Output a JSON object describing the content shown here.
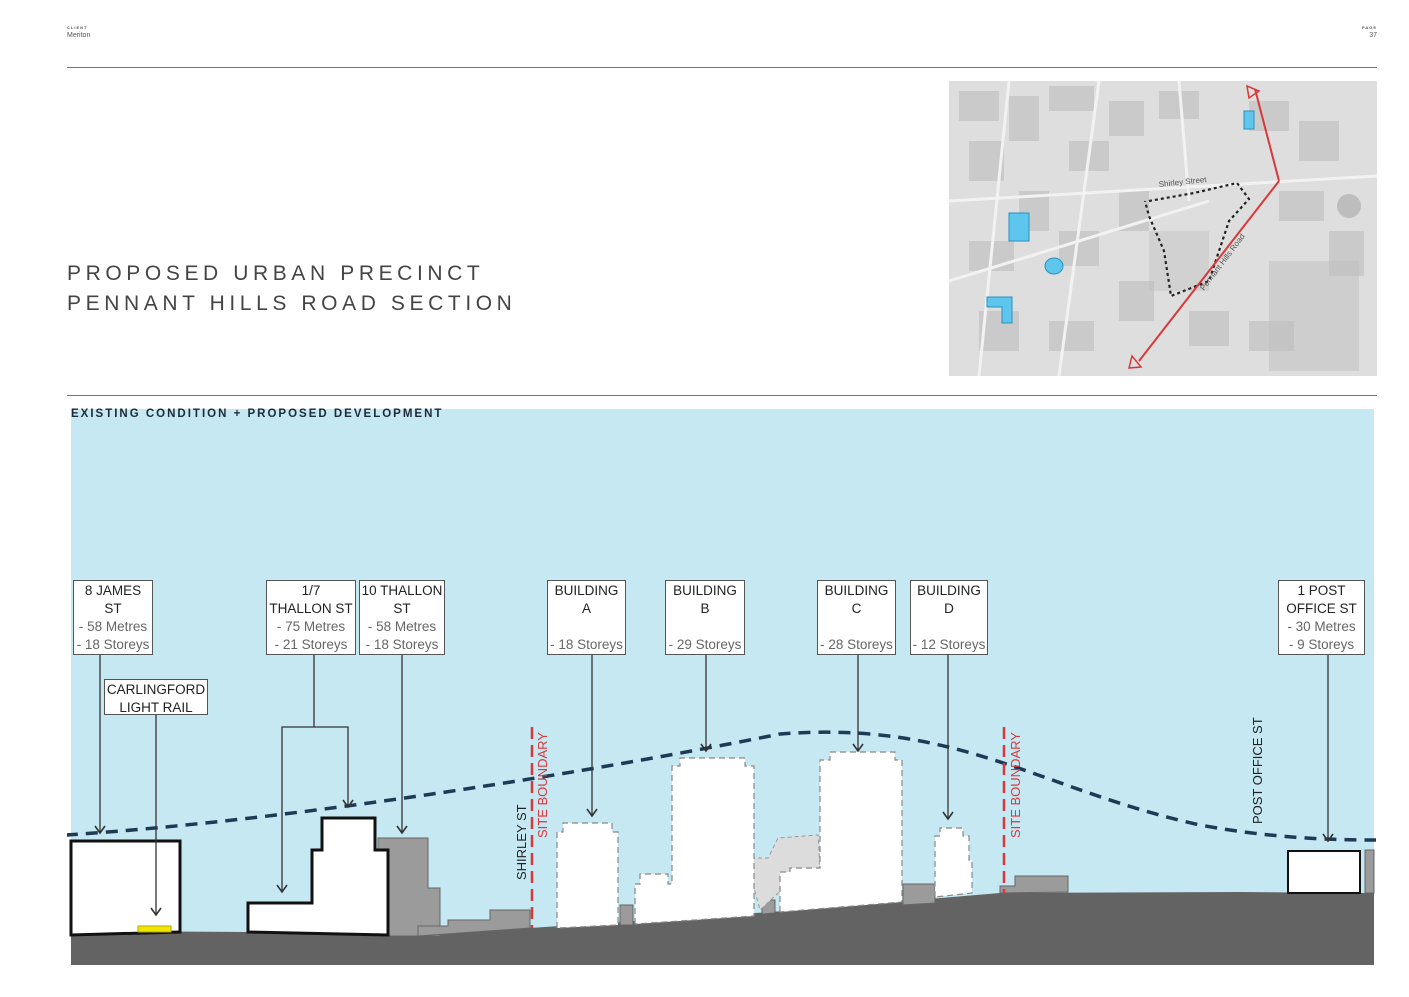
{
  "header": {
    "client_label": "CLIENT",
    "client": "Meriton",
    "page_label": "PAGE",
    "page": "37"
  },
  "title": {
    "line1": "PROPOSED URBAN PRECINCT",
    "line2": "PENNANT HILLS ROAD SECTION"
  },
  "map": {
    "street_shirley": "Shirley Street",
    "street_pennant": "Pennant Hills Road"
  },
  "section": {
    "heading": "EXISTING CONDITION + PROPOSED DEVELOPMENT",
    "labels": [
      {
        "line1": "8 JAMES",
        "line2": "ST",
        "height": "- 58 Metres",
        "storeys": "- 18 Storeys"
      },
      {
        "line1": "1/7",
        "line2": "THALLON ST",
        "height": "- 75 Metres",
        "storeys": "- 21 Storeys"
      },
      {
        "line1": "10 THALLON",
        "line2": "ST",
        "height": "- 58 Metres",
        "storeys": "- 18 Storeys"
      },
      {
        "line1": "BUILDING",
        "line2": "A",
        "height": "",
        "storeys": "- 18 Storeys"
      },
      {
        "line1": "BUILDING",
        "line2": "B",
        "height": "",
        "storeys": "- 29 Storeys"
      },
      {
        "line1": "BUILDING",
        "line2": "C",
        "height": "",
        "storeys": "- 28 Storeys"
      },
      {
        "line1": "BUILDING",
        "line2": "D",
        "height": "",
        "storeys": "- 12 Storeys"
      },
      {
        "line1": "1 POST",
        "line2": "OFFICE ST",
        "height": "- 30 Metres",
        "storeys": "- 9 Storeys"
      }
    ],
    "rail_label": {
      "line1": "CARLINGFORD",
      "line2": "LIGHT RAIL"
    },
    "street_shirley": "SHIRLEY ST",
    "site_boundary": "SITE BOUNDARY",
    "street_post_office": "POST OFFICE ST"
  },
  "colors": {
    "sky": "#c5e8f3",
    "ground": "#636363",
    "boundary": "#d9383a",
    "envelope": "#1f3a55",
    "existing_grey": "#9b9b9b",
    "highlight_blue": "#5ec5ec"
  }
}
